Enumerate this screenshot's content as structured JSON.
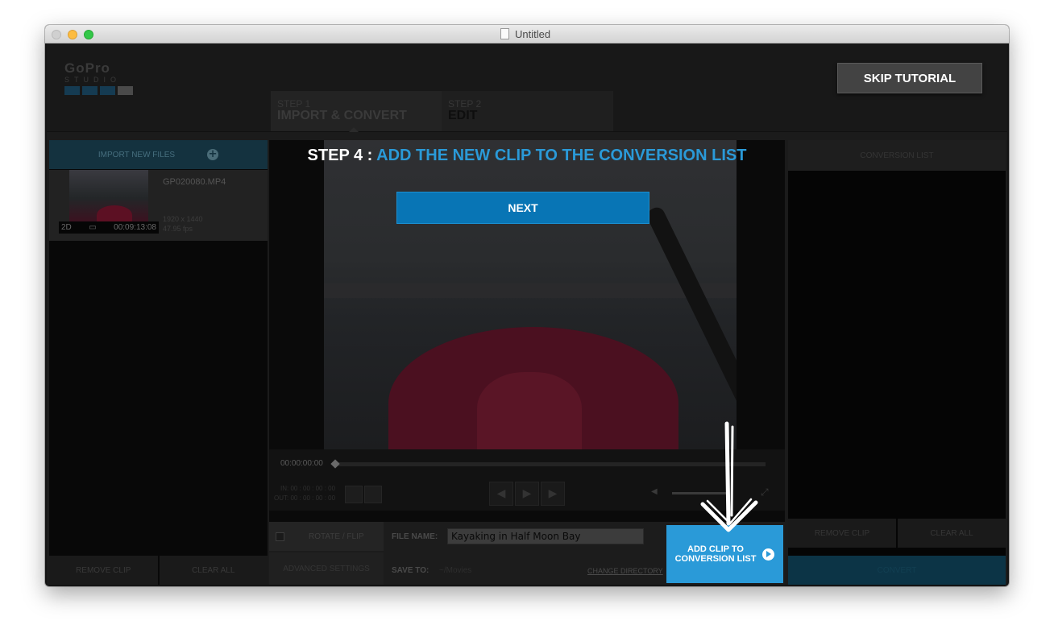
{
  "window": {
    "title": "Untitled"
  },
  "header": {
    "logo_main": "GoPro",
    "logo_sub": "STUDIO",
    "skip_label": "SKIP TUTORIAL",
    "steps": [
      {
        "num": "STEP 1",
        "label": "IMPORT & CONVERT"
      },
      {
        "num": "STEP 2",
        "label": "EDIT"
      }
    ]
  },
  "left_panel": {
    "import_label": "IMPORT NEW FILES",
    "clip": {
      "name": "GP020080.MP4",
      "mode": "2D",
      "duration": "00:09:13:08",
      "resolution": "1920 x 1440",
      "fps": "47.95 fps"
    },
    "remove_label": "REMOVE CLIP",
    "clear_label": "CLEAR ALL"
  },
  "tutorial": {
    "step_label": "STEP 4 :",
    "text": "ADD THE NEW CLIP TO THE CONVERSION LIST",
    "next_label": "NEXT"
  },
  "player": {
    "timecode": "00:00:00:00",
    "in_label": "IN: 00 : 00 : 00 : 00",
    "out_label": "OUT: 00 : 00 : 00 : 00"
  },
  "bottom": {
    "rotate_label": "ROTATE / FLIP",
    "advanced_label": "ADVANCED SETTINGS",
    "file_name_label": "FILE NAME:",
    "file_name_value": "Kayaking in Half Moon Bay",
    "save_to_label": "SAVE TO:",
    "save_to_value": "~/Movies",
    "change_dir_label": "CHANGE DIRECTORY",
    "add_clip_line1": "ADD CLIP TO",
    "add_clip_line2": "CONVERSION LIST"
  },
  "right_panel": {
    "header": "CONVERSION LIST",
    "remove_label": "REMOVE CLIP",
    "clear_label": "CLEAR ALL",
    "convert_label": "CONVERT"
  },
  "colors": {
    "accent": "#2a9ad8",
    "next_button": "#0875b5",
    "background": "#1b1b1b"
  }
}
